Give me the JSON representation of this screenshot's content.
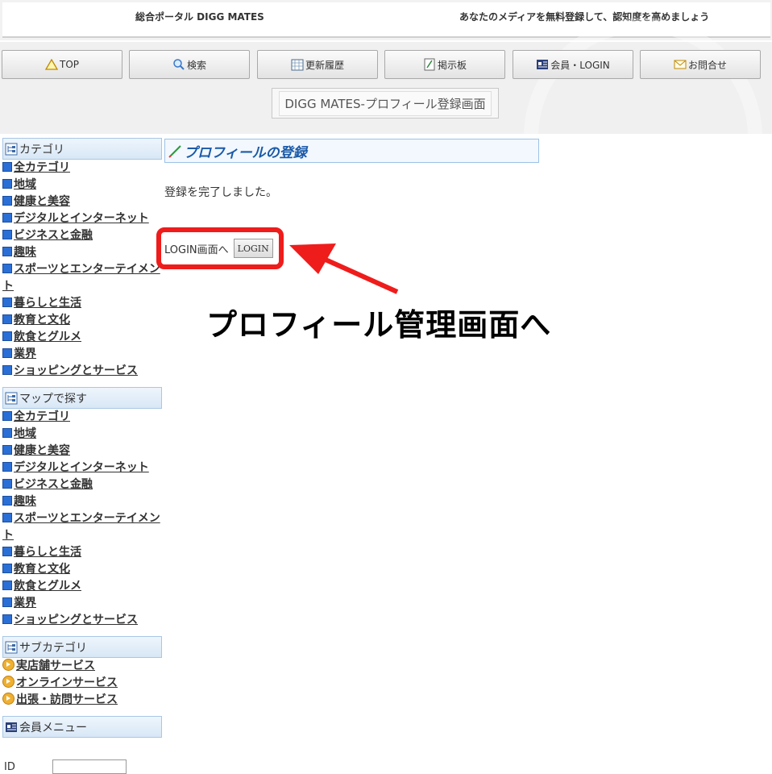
{
  "header": {
    "site_title": "総合ポータル DIGG MATES",
    "tagline": "あなたのメディアを無料登録して、認知度を高めましょう"
  },
  "nav": [
    {
      "label": "TOP",
      "icon": "warning-triangle-icon"
    },
    {
      "label": "検索",
      "icon": "magnifier-icon"
    },
    {
      "label": "更新履歴",
      "icon": "grid-icon"
    },
    {
      "label": "掲示板",
      "icon": "board-icon"
    },
    {
      "label": "会員・LOGIN",
      "icon": "member-card-icon"
    },
    {
      "label": "お問合せ",
      "icon": "envelope-icon"
    }
  ],
  "page_title": "DIGG MATES-プロフィール登録画面",
  "sidebar": {
    "category_head": "カテゴリ",
    "categories": [
      "全カテゴリ",
      "地域",
      "健康と美容",
      "デジタルとインターネット",
      "ビジネスと金融",
      "趣味",
      "スポーツとエンターテイメント",
      "暮らしと生活",
      "教育と文化",
      "飲食とグルメ",
      "業界",
      "ショッピングとサービス"
    ],
    "map_head": "マップで探す",
    "map_items": [
      "全カテゴリ",
      "地域",
      "健康と美容",
      "デジタルとインターネット",
      "ビジネスと金融",
      "趣味",
      "スポーツとエンターテイメント",
      "暮らしと生活",
      "教育と文化",
      "飲食とグルメ",
      "業界",
      "ショッピングとサービス"
    ],
    "sub_head": "サブカテゴリ",
    "sub_items": [
      "実店舗サービス",
      "オンラインサービス",
      "出張・訪問サービス"
    ],
    "member_head": "会員メニュー",
    "id_label": "ID"
  },
  "main": {
    "heading": "プロフィールの登録",
    "done_message": "登録を完了しました。",
    "login_label": "LOGIN画面へ",
    "login_button": "LOGIN"
  },
  "annotation": {
    "text": "プロフィール管理画面へ",
    "color": "#ef1c1c"
  }
}
